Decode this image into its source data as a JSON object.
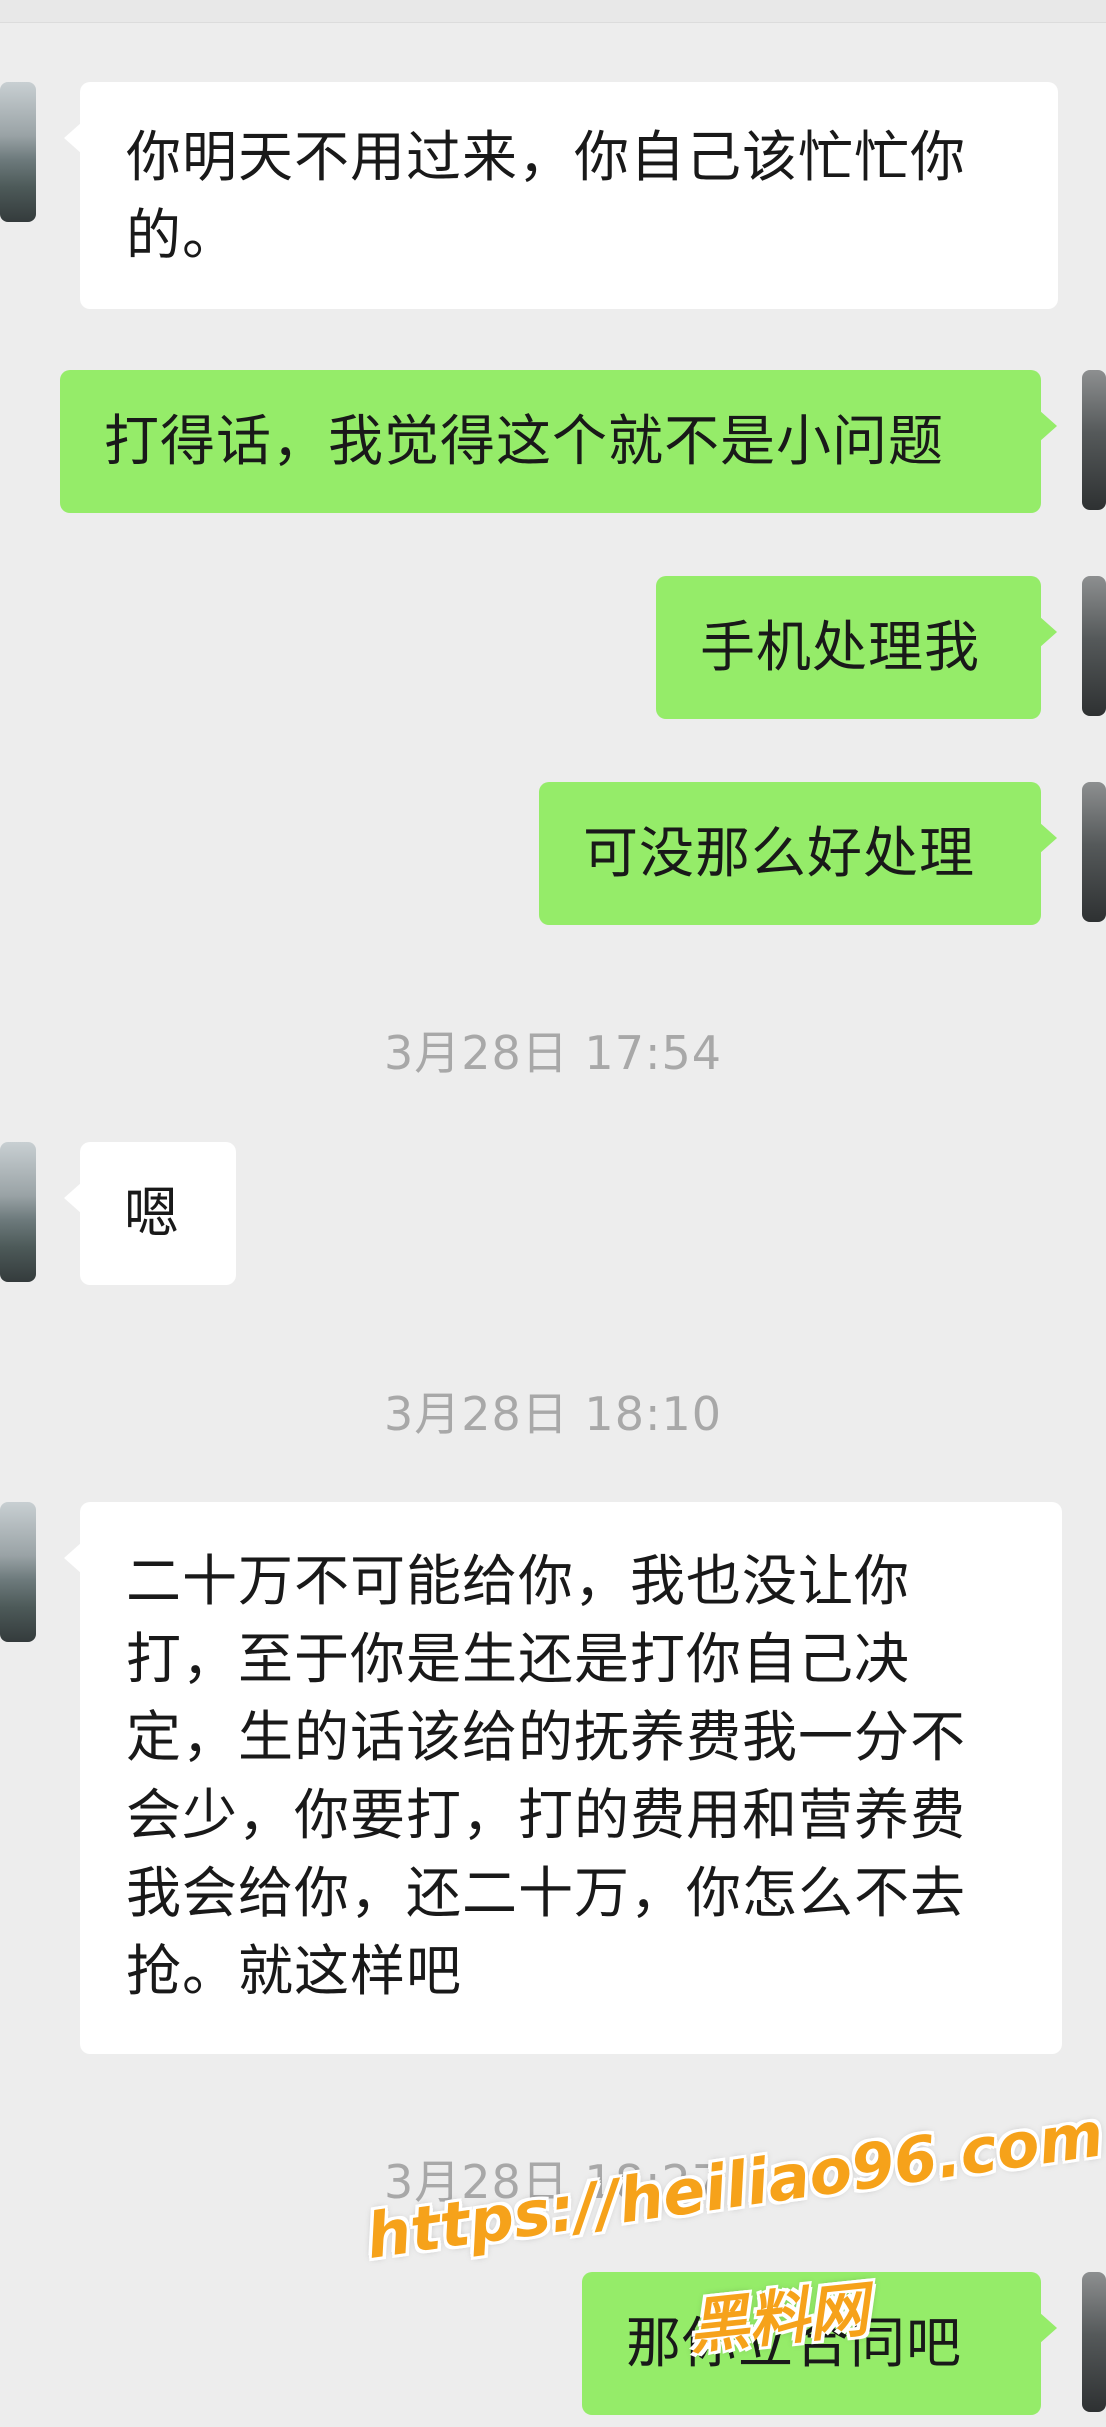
{
  "messages": [
    {
      "side": "in",
      "text": "你明天不用过来，你自己该忙忙你的。"
    },
    {
      "side": "out",
      "text": "打得话，我觉得这个就不是小问题"
    },
    {
      "side": "out",
      "text": "手机处理我"
    },
    {
      "side": "out",
      "text": "可没那么好处理"
    },
    {
      "timestamp": "3月28日 17:54"
    },
    {
      "side": "in",
      "text": "嗯"
    },
    {
      "timestamp": "3月28日 18:10"
    },
    {
      "side": "in",
      "text": "二十万不可能给你，我也没让你打，至于你是生还是打你自己决定，生的话该给的抚养费我一分不会少，你要打，打的费用和营养费我会给你，还二十万，你怎么不去抢。就这样吧"
    },
    {
      "timestamp": "3月28日 18:27"
    },
    {
      "side": "out",
      "text": "那你立合同吧"
    }
  ],
  "watermark": {
    "url": "https://heiliao96.com",
    "site_name": "黑料网",
    "color": "#f6a21a"
  },
  "colors": {
    "background": "#ededed",
    "incoming_bubble": "#ffffff",
    "outgoing_bubble": "#95ec69",
    "timestamp_text": "#a8a8a8"
  }
}
